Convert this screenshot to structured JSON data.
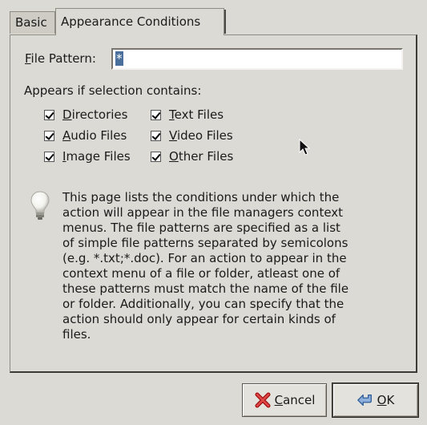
{
  "tabs": {
    "basic_label": "Basic",
    "appearance_label": "Appearance Conditions"
  },
  "file_pattern": {
    "label_mnemonic": "F",
    "label_rest": "ile Pattern:",
    "value": "*"
  },
  "appears_label": "Appears if selection contains:",
  "checks": {
    "directories": {
      "mnemonic": "D",
      "rest": "irectories",
      "checked": true
    },
    "text_files": {
      "mnemonic": "T",
      "rest": "ext Files",
      "checked": true
    },
    "audio_files": {
      "mnemonic": "A",
      "rest": "udio Files",
      "checked": true
    },
    "video_files": {
      "mnemonic": "V",
      "rest": "ideo Files",
      "checked": true
    },
    "image_files": {
      "mnemonic": "I",
      "rest": "mage Files",
      "checked": true
    },
    "other_files": {
      "mnemonic": "O",
      "rest": "ther Files",
      "checked": true
    }
  },
  "info_lines": [
    "This page lists the conditions under which the",
    "action will appear in the file managers context",
    "menus. The file patterns are specified as a list",
    "of simple file patterns separated by semicolons",
    "(e.g. *.txt;*.doc). For an action to appear in the",
    "context menu of a file or folder, atleast one of",
    "these patterns must match the name of the file",
    "or folder. Additionally, you can specify that the",
    "action should only appear for certain kinds of",
    "files."
  ],
  "buttons": {
    "cancel_mnemonic": "C",
    "cancel_rest": "ancel",
    "ok_mnemonic": "O",
    "ok_rest": "K"
  },
  "icons": {
    "cancel": "cancel-x-icon",
    "ok": "ok-arrow-icon",
    "info": "lightbulb-icon"
  }
}
